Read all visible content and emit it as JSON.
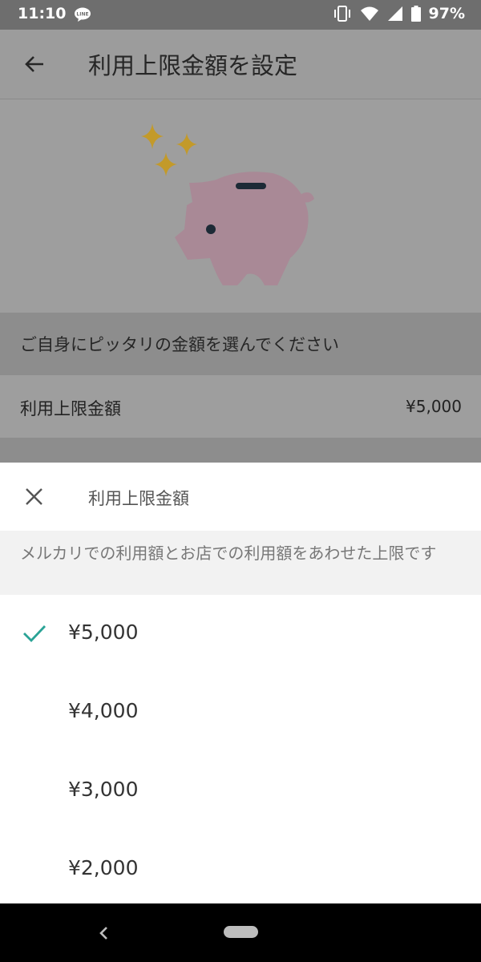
{
  "status_bar": {
    "time": "11:10",
    "battery": "97%"
  },
  "app_bar": {
    "title": "利用上限金額を設定"
  },
  "page": {
    "prompt": "ご自身にピッタリの金額を選んでください",
    "limit_label": "利用上限金額",
    "limit_value": "¥5,000"
  },
  "sheet": {
    "title": "利用上限金額",
    "description": "メルカリでの利用額とお店での利用額をあわせた上限です",
    "options": [
      {
        "amount": "¥5,000",
        "selected": true
      },
      {
        "amount": "¥4,000",
        "selected": false
      },
      {
        "amount": "¥3,000",
        "selected": false
      },
      {
        "amount": "¥2,000",
        "selected": false
      }
    ]
  },
  "colors": {
    "accent": "#2aa396",
    "scrim": "#9e9e9e",
    "sparkle": "#c39a2a",
    "pig": "#a98996"
  }
}
